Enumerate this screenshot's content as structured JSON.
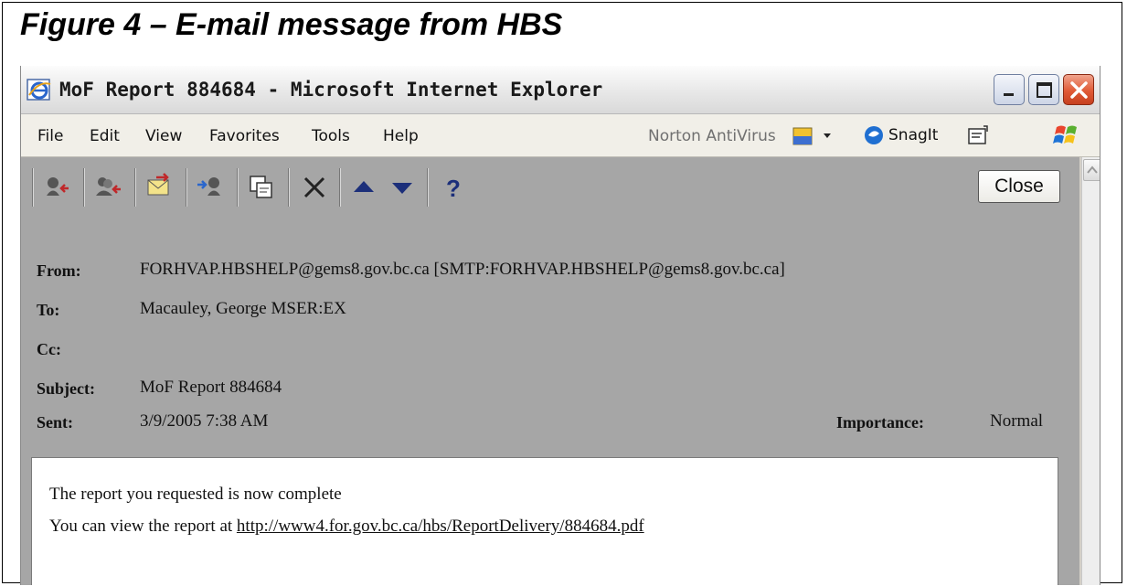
{
  "figure": {
    "caption": "Figure 4 – E-mail message from HBS"
  },
  "window": {
    "title": "MoF Report 884684 - Microsoft Internet Explorer",
    "controls": [
      "minimize-icon",
      "maximize-icon",
      "close-icon"
    ],
    "colors": {
      "close_button": "#e05a36",
      "title_bar": "#e6e6e6",
      "toolbar": "#a6a6a6"
    }
  },
  "menu": {
    "items": [
      "File",
      "Edit",
      "View",
      "Favorites",
      "Tools",
      "Help"
    ],
    "norton": "Norton AntiVirus",
    "snagit": "SnagIt"
  },
  "toolbar": {
    "icons": [
      "reply-icon",
      "reply-all-icon",
      "forward-icon",
      "forward-sender-icon",
      "copy-icon",
      "delete-icon",
      "previous-icon",
      "next-icon",
      "help-icon"
    ],
    "close_label": "Close"
  },
  "message": {
    "from_label": "From:",
    "from": "FORHVAP.HBSHELP@gems8.gov.bc.ca [SMTP:FORHVAP.HBSHELP@gems8.gov.bc.ca]",
    "to_label": "To:",
    "to": "Macauley, George MSER:EX",
    "cc_label": "Cc:",
    "cc": "",
    "subject_label": "Subject:",
    "subject": "MoF Report 884684",
    "sent_label": "Sent:",
    "sent": "3/9/2005 7:38 AM",
    "importance_label": "Importance:",
    "importance": "Normal",
    "body_line1": "The report you requested is now complete",
    "body_line2_prefix": "You can view the report at ",
    "body_link": "http://www4.for.gov.bc.ca/hbs/ReportDelivery/884684.pdf"
  }
}
